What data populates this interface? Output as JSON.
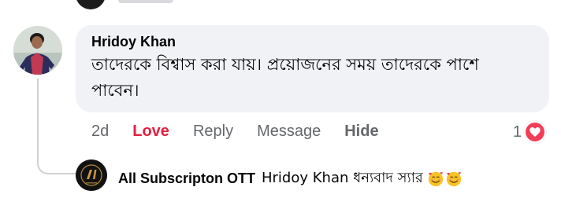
{
  "comment": {
    "author": "Hridoy Khan",
    "text": "তাদেরকে বিশ্বাস করা যায়। প্রয়োজনের সময় তাদেরকে পাশে পাবেন।"
  },
  "actions": {
    "time": "2d",
    "love": "Love",
    "reply": "Reply",
    "message": "Message",
    "hide": "Hide"
  },
  "reactions": {
    "count": "1",
    "type_icon": "heart-icon",
    "color": "#f33e58"
  },
  "reply": {
    "author": "All Subscripton OTT",
    "text": "Hridoy Khan ধন্যবাদ স্যার",
    "emoji_icon": "smiling-face-with-hearts-icon"
  },
  "colors": {
    "bubble": "#f0f2f5",
    "love": "#e41e3f",
    "secondary_text": "#65676b"
  }
}
